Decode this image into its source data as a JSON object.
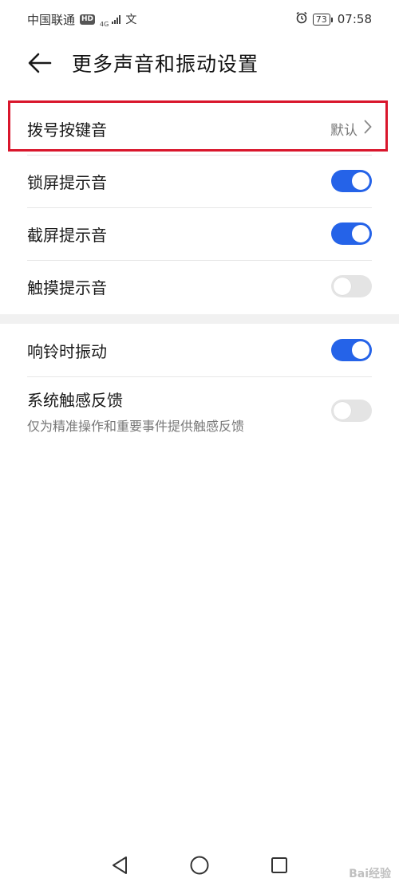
{
  "status_bar": {
    "carrier": "中国联通",
    "hd": "HD",
    "network": "4G",
    "extra_icon": "文",
    "battery": "73",
    "time": "07:58"
  },
  "header": {
    "title": "更多声音和振动设置"
  },
  "section1": {
    "items": [
      {
        "label": "拨号按键音",
        "value": "默认"
      },
      {
        "label": "锁屏提示音",
        "enabled": true
      },
      {
        "label": "截屏提示音",
        "enabled": true
      },
      {
        "label": "触摸提示音",
        "enabled": false
      }
    ]
  },
  "section2": {
    "items": [
      {
        "label": "响铃时振动",
        "enabled": true
      },
      {
        "label": "系统触感反馈",
        "subtitle": "仅为精准操作和重要事件提供触感反馈",
        "enabled": false
      }
    ]
  },
  "watermark": "Bai经验",
  "colors": {
    "accent": "#2563e8",
    "highlight": "#d9162c",
    "toggle_off": "#e4e4e4"
  },
  "icons": {
    "back": "back-arrow-icon",
    "chevron": "chevron-right-icon",
    "alarm": "alarm-icon",
    "nav_back": "nav-back-icon",
    "nav_home": "nav-home-icon",
    "nav_recent": "nav-recent-icon"
  }
}
